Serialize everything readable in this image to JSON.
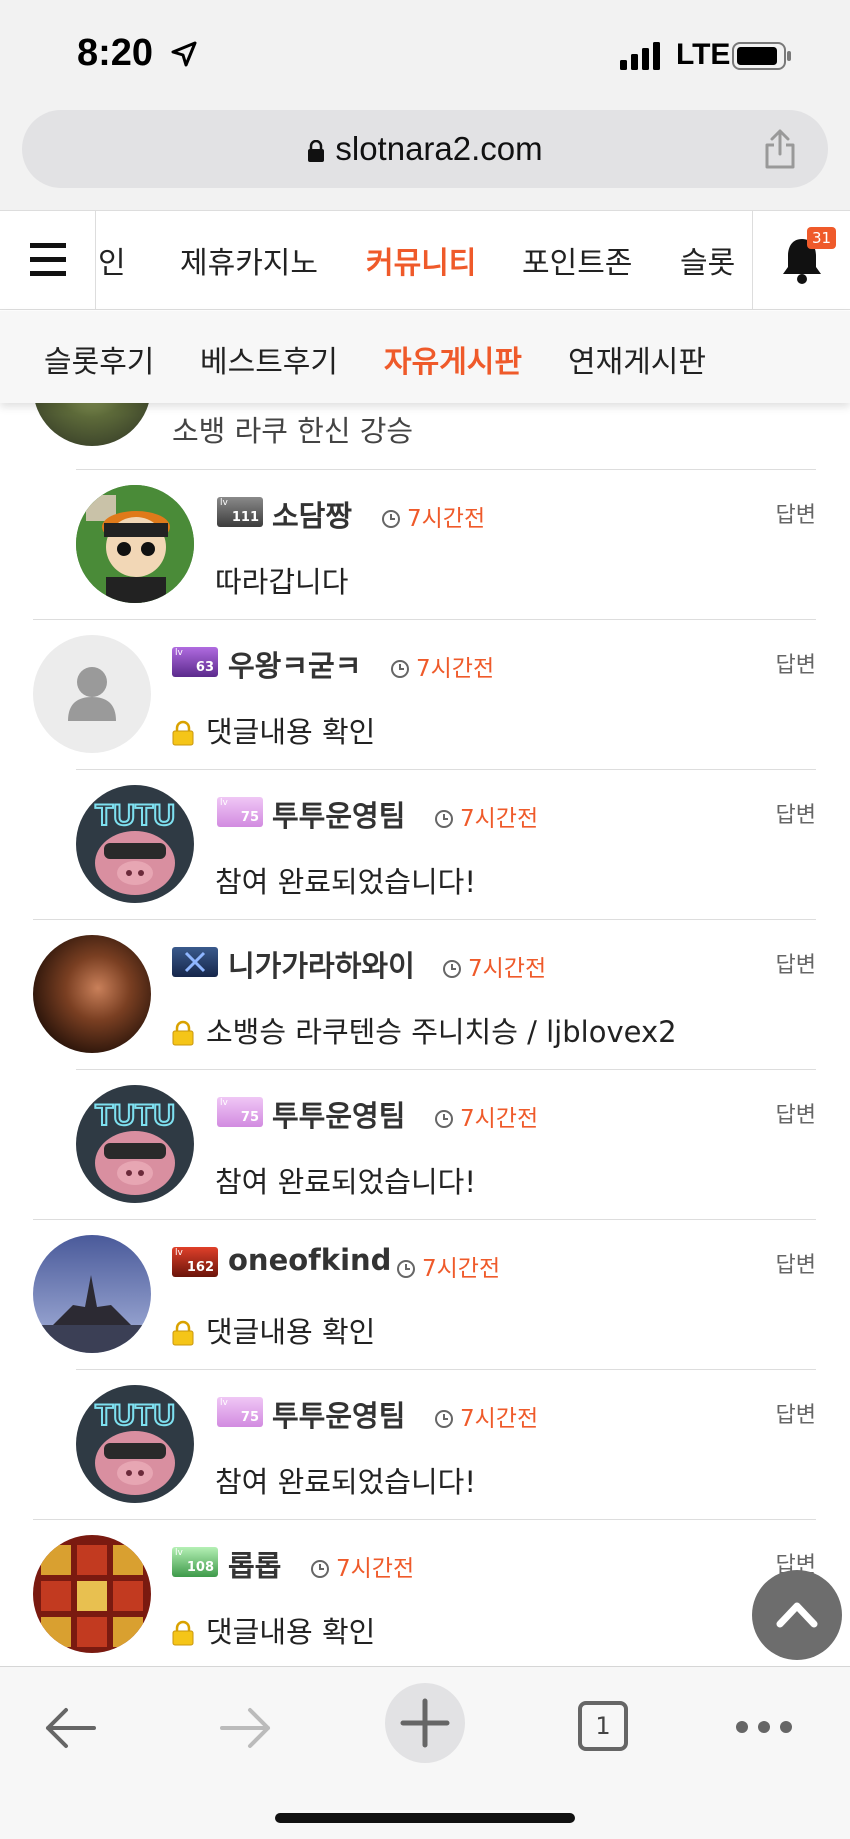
{
  "status": {
    "time": "8:20",
    "network": "LTE"
  },
  "browser": {
    "url": "slotnara2.com",
    "tab_count": "1"
  },
  "nav": {
    "items": [
      "인",
      "제휴카지노",
      "커뮤니티",
      "포인트존",
      "슬롯"
    ],
    "active": "커뮤니티",
    "notification_count": "31"
  },
  "subnav": {
    "items": [
      "슬롯후기",
      "베스트후기",
      "자유게시판",
      "연재게시판"
    ],
    "active": "자유게시판"
  },
  "comments": [
    {
      "name": "",
      "level": "",
      "time": "",
      "reply_label": "",
      "text": "소뱅 라쿠 한신 강승",
      "locked": false,
      "nested": false
    },
    {
      "name": "소담짱",
      "level": "111",
      "time": "7시간전",
      "reply_label": "답변",
      "text": "따라갑니다",
      "locked": false,
      "nested": true
    },
    {
      "name": "우왕ㅋ굳ㅋ",
      "level": "63",
      "time": "7시간전",
      "reply_label": "답변",
      "text": "댓글내용 확인",
      "locked": true,
      "nested": false
    },
    {
      "name": "투투운영팀",
      "level": "75",
      "time": "7시간전",
      "reply_label": "답변",
      "text": "참여 완료되었습니다!",
      "locked": false,
      "nested": true
    },
    {
      "name": "니가가라하와이",
      "level": "",
      "time": "7시간전",
      "reply_label": "답변",
      "text": "소뱅승 라쿠텐승 주니치승 / ljblovex2",
      "locked": true,
      "nested": false
    },
    {
      "name": "투투운영팀",
      "level": "75",
      "time": "7시간전",
      "reply_label": "답변",
      "text": "참여 완료되었습니다!",
      "locked": false,
      "nested": true
    },
    {
      "name": "oneofkind",
      "level": "162",
      "time": "7시간전",
      "reply_label": "답변",
      "text": "댓글내용 확인",
      "locked": true,
      "nested": false
    },
    {
      "name": "투투운영팀",
      "level": "75",
      "time": "7시간전",
      "reply_label": "답변",
      "text": "참여 완료되었습니다!",
      "locked": false,
      "nested": true
    },
    {
      "name": "롭롭",
      "level": "108",
      "time": "7시간전",
      "reply_label": "답변",
      "text": "댓글내용 확인",
      "locked": true,
      "nested": false
    }
  ],
  "colors": {
    "accent": "#ef5a2a",
    "divider": "#dddddd"
  }
}
